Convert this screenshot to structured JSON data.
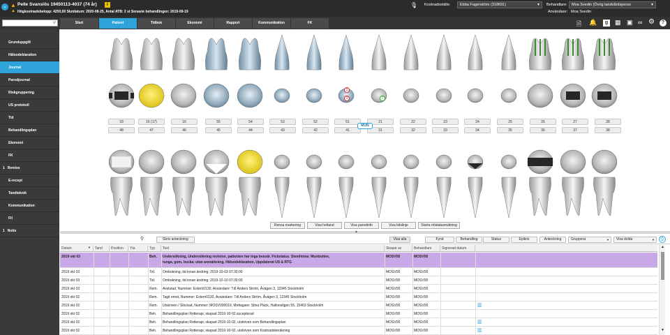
{
  "topbar": {
    "patient_name": "Pelle Svanslös 19450113-4037 (74 år)",
    "patient_info": "Högkostnadsbelopp: 4250,00 Slutdatum: 2020-08-25, Antal ATB: 2 st Senaste behandlingen: 2019-09-19",
    "kostnadsstalle_label": "Kostnadsställe:",
    "kostnadsstalle_value": "Ebba Fagerström (318691)",
    "behandlare_label": "Behandlare:",
    "behandlare_value": "Moa Svedin (Övrig tandvårdsperso",
    "anvandare_label": "Användare:",
    "anvandare_value": "Moa Svedin"
  },
  "search": {
    "placeholder": ""
  },
  "tabs": [
    {
      "label": "Start"
    },
    {
      "label": "Patient"
    },
    {
      "label": "Tidbok"
    },
    {
      "label": "Ekonomi"
    },
    {
      "label": "Rapport"
    },
    {
      "label": "Kommunikation"
    },
    {
      "label": "FK"
    }
  ],
  "sidebar": {
    "items": [
      {
        "label": "Grunduppgift"
      },
      {
        "label": "Hälsodeklaration"
      },
      {
        "label": "Journal"
      },
      {
        "label": "Parodjournal"
      },
      {
        "label": "Riskgruppering"
      },
      {
        "label": "US protokoll"
      },
      {
        "label": "Tid"
      },
      {
        "label": "Behandlingsplan"
      },
      {
        "label": "Ekonomi"
      },
      {
        "label": "FK"
      },
      {
        "label": "Remiss",
        "badge": "1"
      },
      {
        "label": "E-recept"
      },
      {
        "label": "Tandteknik"
      },
      {
        "label": "Kommunikation"
      },
      {
        "label": "Fil"
      },
      {
        "label": "Notis",
        "badge": "1"
      }
    ]
  },
  "chart": {
    "upper_numbers": [
      "18",
      "16 (17)",
      "16",
      "55",
      "54",
      "53",
      "52",
      "51",
      "21",
      "22",
      "23",
      "24",
      "25",
      "26",
      "27",
      "28"
    ],
    "lower_numbers": [
      "48",
      "47",
      "46",
      "45",
      "44",
      "43",
      "42",
      "41",
      "31",
      "32",
      "33",
      "34",
      "35",
      "36",
      "37",
      "38"
    ],
    "mun_label": "MUN",
    "marker_3a": "3",
    "marker_3b": "3",
    "marker_2": "2",
    "buttons": [
      "Rensa markering",
      "Visa heltand",
      "Visa parodinfo",
      "Visa tidslinje",
      "Starta rötstatusmätning"
    ]
  },
  "journal_toolbar": {
    "write_note": "Skriv anteckning",
    "visa_alla": "Visa alla",
    "fynd": "Fynd",
    "behandling": "Behandling",
    "status": "Status",
    "epikris": "Epikris",
    "anteckning": "Anteckning",
    "grupperna": "Gruppera",
    "visa_dolda": "Visa dolda"
  },
  "table": {
    "columns": [
      "Datum",
      "Tand",
      "Position",
      "Yta",
      "Typ",
      "Text",
      "Skapat av",
      "Behandlare",
      "Signerad datum"
    ],
    "rows": [
      {
        "date": "2019 okt 03",
        "typ": "Beh.",
        "text": "Undersökning, Undersökning revision, patienten har inga besvär. Fickstatus. Slemhinna: Munbotten,",
        "text2": "tunga, gom, bucka: utan anmärkning. Hälsodeklaration, Uppdaterat US & RTG",
        "skapat": "MOSV00",
        "behandlare": "MOSV00",
        "highlight": true
      },
      {
        "date": "2019 okt 03",
        "typ": "Tid.",
        "text": "Ombokning, tid innan ändring: 2019-10-03 07:30:00",
        "skapat": "MOSV00",
        "behandlare": "MOSV00"
      },
      {
        "date": "2019 okt 03",
        "typ": "Tid.",
        "text": "Ombokning, tid innan ändring: 2019-10-10 07:30:00",
        "skapat": "MOSV00",
        "behandlare": "MOSV00"
      },
      {
        "date": "2019 okt 03",
        "typ": "Rem.",
        "text": "Avslutad, Nummer: Extern0130, Avsändare: Tdl Anders Ström, Åvägen 3, 12345 Stockholm",
        "skapat": "MOSV00",
        "behandlare": "MOSV00"
      },
      {
        "date": "2019 okt 02",
        "typ": "Rem.",
        "text": "Tagit emot, Nummer: Extern0130, Avsändare: Tdl Anders Ström, Åvägen 3, 12345 Stockholm",
        "skapat": "MOSV00",
        "behandlare": "MOSV00"
      },
      {
        "date": "2019 okt 02",
        "typ": "Rem.",
        "text": "Utskriven / Skickad, Nummer: MOSV000019, Mottagare: Stina Plack, Hallonstigen 55, 15463 Stockholm",
        "skapat": "MOSV00",
        "behandlare": "MOSV00",
        "attach": true
      },
      {
        "date": "2019 okt 02",
        "typ": "Beh.",
        "text": "Behandlingsplan Rotterapi, skapad 2019-10-02 accepterad",
        "skapat": "MOSV00",
        "behandlare": "MOSV00"
      },
      {
        "date": "2019 okt 02",
        "typ": "Beh.",
        "text": "Behandlingsplan Rotterapi, skapad 2019-10-02, utskriven som Behandlingsplan",
        "skapat": "MOSV00",
        "behandlare": "MOSV00",
        "attach": true
      },
      {
        "date": "2019 okt 02",
        "typ": "Beh.",
        "text": "Behandlingsplan Rotterapi, skapad 2019-10-02, utskriven som Kostnadsberäkning",
        "skapat": "MOSV00",
        "behandlare": "MOSV00",
        "attach": true
      }
    ]
  },
  "colors": {
    "accent": "#2ea3d9",
    "highlight_row": "#c9a8e8",
    "filling_yellow": "#e9d21f",
    "crown_dark": "#262626",
    "implant_green": "#3b8a2f"
  }
}
